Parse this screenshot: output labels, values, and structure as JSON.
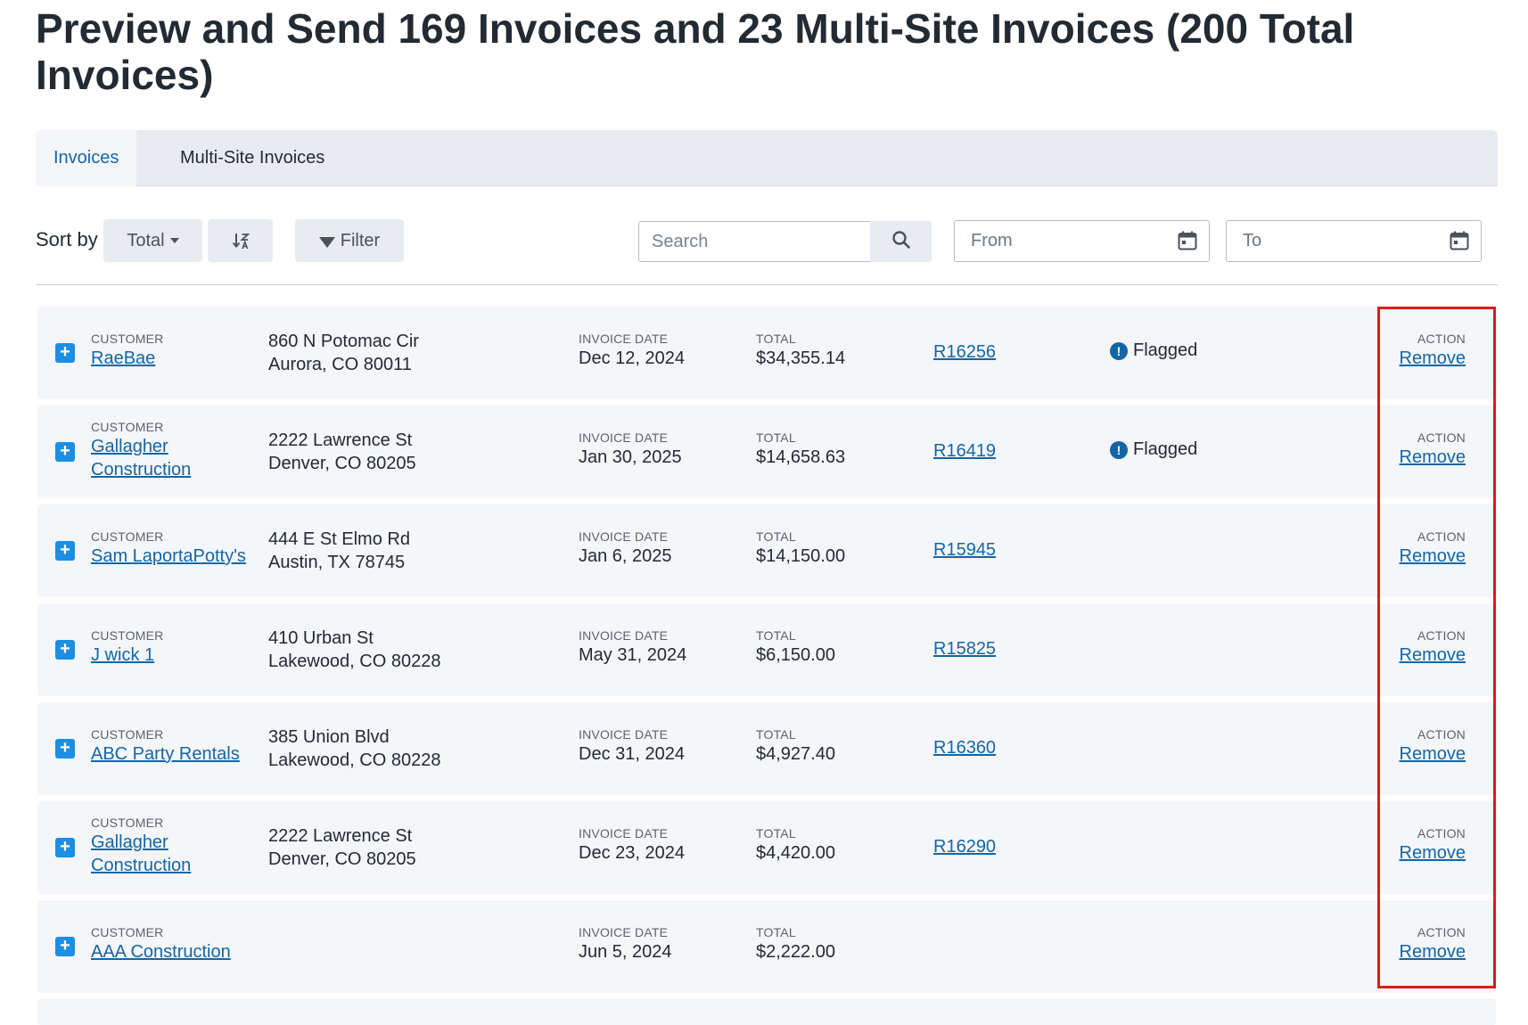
{
  "page": {
    "title": "Preview and Send 169 Invoices and 23 Multi-Site Invoices (200 Total Invoices)"
  },
  "tabs": [
    {
      "label": "Invoices",
      "active": true
    },
    {
      "label": "Multi-Site Invoices",
      "active": false
    }
  ],
  "toolbar": {
    "sort_label": "Sort by",
    "sort_value": "Total",
    "sort_direction_icon": "sort-descending-icon",
    "filter_label": "Filter",
    "search_placeholder": "Search",
    "from_placeholder": "From",
    "to_placeholder": "To"
  },
  "labels": {
    "customer": "CUSTOMER",
    "invoice_date": "INVOICE DATE",
    "total": "TOTAL",
    "action": "ACTION"
  },
  "invoices": [
    {
      "customer_line1": "RaeBae",
      "customer_line2": "",
      "address_line1": "860 N Potomac Cir",
      "address_line2": "Aurora, CO 80011",
      "invoice_date": "Dec 12, 2024",
      "total": "$34,355.14",
      "ref": "R16256",
      "status": "Flagged",
      "action": "Remove"
    },
    {
      "customer_line1": "Gallagher",
      "customer_line2": "Construction",
      "address_line1": "2222 Lawrence St",
      "address_line2": "Denver, CO 80205",
      "invoice_date": "Jan 30, 2025",
      "total": "$14,658.63",
      "ref": "R16419",
      "status": "Flagged",
      "action": "Remove"
    },
    {
      "customer_line1": "Sam LaportaPotty's",
      "customer_line2": "",
      "address_line1": "444 E St Elmo Rd",
      "address_line2": "Austin, TX 78745",
      "invoice_date": "Jan 6, 2025",
      "total": "$14,150.00",
      "ref": "R15945",
      "status": "",
      "action": "Remove"
    },
    {
      "customer_line1": "J wick 1",
      "customer_line2": "",
      "address_line1": "410 Urban St",
      "address_line2": "Lakewood, CO 80228",
      "invoice_date": "May 31, 2024",
      "total": "$6,150.00",
      "ref": "R15825",
      "status": "",
      "action": "Remove"
    },
    {
      "customer_line1": "ABC Party Rentals",
      "customer_line2": "",
      "address_line1": "385 Union Blvd",
      "address_line2": "Lakewood, CO 80228",
      "invoice_date": "Dec 31, 2024",
      "total": "$4,927.40",
      "ref": "R16360",
      "status": "",
      "action": "Remove"
    },
    {
      "customer_line1": "Gallagher",
      "customer_line2": "Construction",
      "address_line1": "2222 Lawrence St",
      "address_line2": "Denver, CO 80205",
      "invoice_date": "Dec 23, 2024",
      "total": "$4,420.00",
      "ref": "R16290",
      "status": "",
      "action": "Remove"
    },
    {
      "customer_line1": "AAA Construction",
      "customer_line2": "",
      "address_line1": "",
      "address_line2": "",
      "invoice_date": "Jun 5, 2024",
      "total": "$2,222.00",
      "ref": "",
      "status": "",
      "action": "Remove"
    }
  ],
  "colors": {
    "accent": "#1466a5",
    "expand": "#1a8fe3",
    "highlight": "#e01a1a",
    "row_bg": "#f4f6f9",
    "tab_bar_bg": "#e8ecf1"
  }
}
